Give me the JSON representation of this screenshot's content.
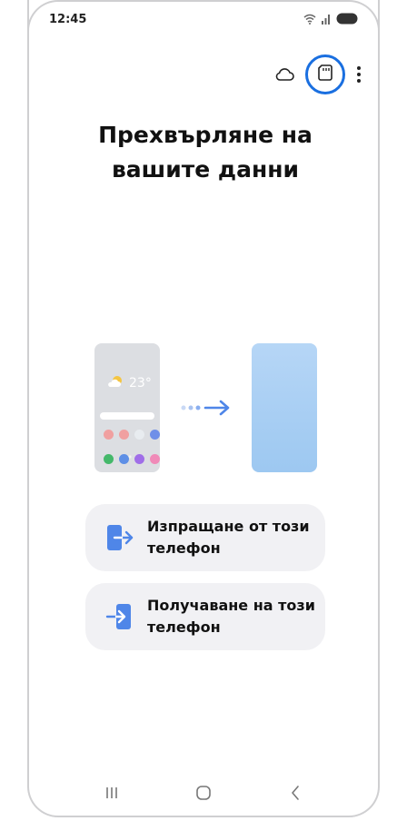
{
  "status": {
    "time": "12:45",
    "icons": [
      "wifi-icon",
      "signal-icon",
      "battery-icon"
    ]
  },
  "top_actions": [
    "cloud-icon",
    "sd-card-icon",
    "more-options-icon"
  ],
  "title": "Прехвърляне на вашите данни",
  "illustration": {
    "weather_temp": "23°",
    "colors": {
      "old_phone": "#dcdee2",
      "new_phone": "#a6cdf3",
      "arrow": "#4f86e8"
    }
  },
  "options": [
    {
      "label": "Изпращане от този телефон",
      "icon": "send-phone-icon"
    },
    {
      "label": "Получаване на този телефон",
      "icon": "receive-phone-icon"
    }
  ],
  "nav": [
    "recents-icon",
    "home-icon",
    "back-icon"
  ],
  "colors": {
    "accent": "#1a6fe0",
    "option_bg": "#f1f1f4"
  }
}
